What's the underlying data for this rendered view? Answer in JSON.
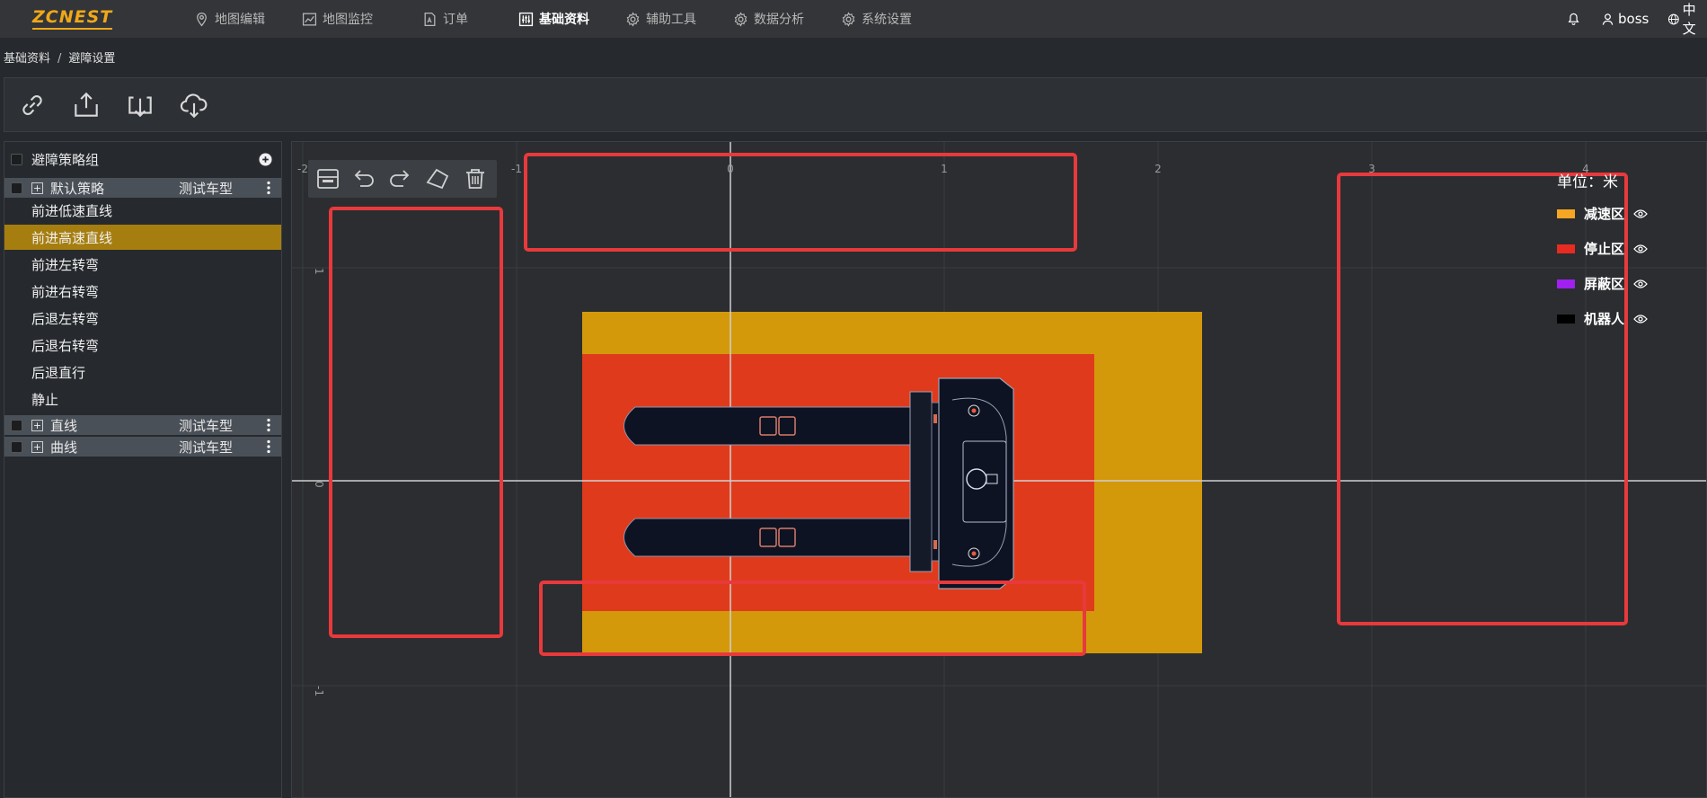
{
  "app": {
    "logo": "ZCNEST"
  },
  "nav": {
    "items": [
      {
        "label": "地图编辑",
        "icon": "location-pin-icon"
      },
      {
        "label": "地图监控",
        "icon": "chart-monitor-icon"
      },
      {
        "label": "订单",
        "icon": "document-icon"
      },
      {
        "label": "基础资料",
        "icon": "sliders-icon",
        "active": true
      },
      {
        "label": "辅助工具",
        "icon": "gear-icon"
      },
      {
        "label": "数据分析",
        "icon": "gear-icon"
      },
      {
        "label": "系统设置",
        "icon": "gear-icon"
      }
    ],
    "user": "boss",
    "language": "中文"
  },
  "breadcrumb": {
    "root": "基础资料",
    "separator": "/",
    "current": "避障设置"
  },
  "toolbar": {
    "icons": [
      "link-icon",
      "upload-icon",
      "download-icon",
      "cloud-download-icon"
    ]
  },
  "sidebar": {
    "header": "避障策略组",
    "groups": [
      {
        "name": "默认策略",
        "model": "测试车型",
        "items": [
          "前进低速直线",
          "前进高速直线",
          "前进左转弯",
          "前进右转弯",
          "后退左转弯",
          "后退右转弯",
          "后退直行",
          "静止"
        ],
        "selected_index": 1
      },
      {
        "name": "直线",
        "model": "测试车型"
      },
      {
        "name": "曲线",
        "model": "测试车型"
      }
    ]
  },
  "canvas": {
    "float_tools": [
      "save-icon",
      "undo-icon",
      "redo-icon",
      "polygon-icon",
      "trash-icon"
    ],
    "x_ticks": [
      "-2",
      "-1",
      "0",
      "1",
      "2",
      "3",
      "4"
    ],
    "y_ticks": [
      "1",
      "0",
      "-1"
    ],
    "legend": {
      "unit": "单位：米",
      "items": [
        {
          "label": "减速区",
          "color": "#f5a623"
        },
        {
          "label": "停止区",
          "color": "#e82b20"
        },
        {
          "label": "屏蔽区",
          "color": "#a020f0"
        },
        {
          "label": "机器人",
          "color": "#000000"
        }
      ]
    },
    "colors": {
      "slow_zone": "#d3990b",
      "stop_zone": "#e03a1c",
      "annotation": "#e8393c",
      "axis": "#cfcfcf",
      "grid": "#3a3d41"
    }
  }
}
